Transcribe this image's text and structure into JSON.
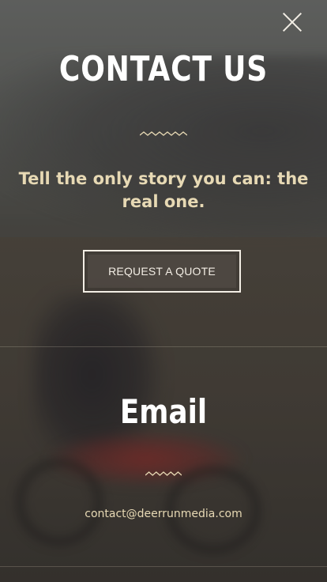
{
  "header": {
    "title": "CONTACT US"
  },
  "intro": {
    "tagline": "Tell the only story you can: the real one.",
    "cta_label": "REQUEST A QUOTE"
  },
  "email_section": {
    "heading": "Email",
    "address": "contact@deerrunmedia.com"
  },
  "icons": {
    "close": "close-icon",
    "divider_top": "zigzag-divider-icon",
    "divider_email": "zigzag-divider-icon"
  },
  "colors": {
    "accent": "#e7d9b4",
    "title": "#ffffff",
    "button_border": "#f3eee5"
  }
}
